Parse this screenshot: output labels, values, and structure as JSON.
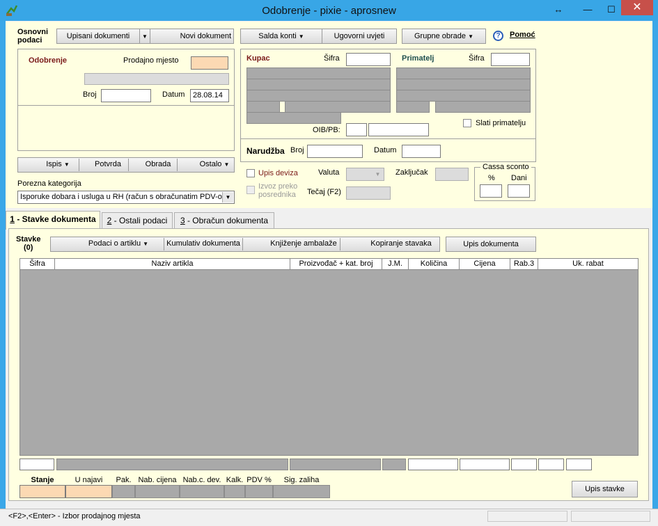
{
  "window": {
    "title": "Odobrenje - pixie - aprosnew",
    "resize_icon": "↔",
    "minimize_icon": "—",
    "maximize_icon": "☐",
    "close_icon": "✕"
  },
  "colors": {
    "title_bar": "#38a6e6",
    "panel_bg": "#ffffe1",
    "section_label": "#7a1a1a",
    "primatelj_label": "#1f4f4f",
    "readonly_gray": "#a9a9a9",
    "peach": "#fcd9b3"
  },
  "toolbar": {
    "section_label_line1": "Osnovni",
    "section_label_line2": "podaci",
    "upisani_dokumenti": "Upisani dokumenti",
    "novi_dokument": "Novi dokument",
    "salda_konti": "Salda konti",
    "ugovorni_uvjeti": "Ugovorni uvjeti",
    "grupne_obrade": "Grupne obrade",
    "help_icon": "?",
    "pomoc": "Pomoć"
  },
  "odobrenje": {
    "title": "Odobrenje",
    "prodajno_mjesto_label": "Prodajno mjesto",
    "prodajno_mjesto_value": "",
    "broj_label": "Broj",
    "broj_value": "",
    "datum_label": "Datum",
    "datum_value": "28.08.14"
  },
  "actions": {
    "ispis": "Ispis",
    "potvrda": "Potvrda",
    "obrada": "Obrada",
    "ostalo": "Ostalo"
  },
  "porezna": {
    "label": "Porezna kategorija",
    "selected": "Isporuke dobara i usluga u RH (račun s obračunatim PDV-om)"
  },
  "kupac": {
    "title": "Kupac",
    "sifra_label": "Šifra",
    "oib_label": "OIB/PB:"
  },
  "primatelj": {
    "title": "Primatelj",
    "sifra_label": "Šifra",
    "slati_label": "Slati primatelju"
  },
  "narudzba": {
    "title": "Narudžba",
    "broj_label": "Broj",
    "datum_label": "Datum"
  },
  "deviza": {
    "upis_deviza": "Upis deviza",
    "izvoz_line1": "Izvoz preko",
    "izvoz_line2": "posrednika",
    "valuta_label": "Valuta",
    "tecaj_label": "Tečaj (F2)",
    "zakljucak_label": "Zaključak"
  },
  "cassa": {
    "title": "Cassa sconto",
    "percent_label": "%",
    "dani_label": "Dani"
  },
  "tabs": [
    {
      "num": "1",
      "label": " - Stavke dokumenta"
    },
    {
      "num": "2",
      "label": " - Ostali podaci"
    },
    {
      "num": "3",
      "label": " - Obračun dokumenta"
    }
  ],
  "stavke": {
    "label_line1": "Stavke",
    "label_line2": "(0)",
    "podaci_o_artiklu": "Podaci o artiklu",
    "kumulativ": "Kumulativ dokumenta",
    "knjizenje": "Knjiženje ambalaže",
    "kopiranje": "Kopiranje stavaka",
    "upis_dokumenta": "Upis dokumenta"
  },
  "grid_columns": [
    "Šifra",
    "Naziv artikla",
    "Proizvođač + kat. broj",
    "J.M.",
    "Količina",
    "Cijena",
    "Rab.3",
    "Uk. rabat"
  ],
  "summary_columns": [
    "Stanje",
    "U najavi",
    "Pak.",
    "Nab. cijena",
    "Nab.c. dev.",
    "Kalk.",
    "PDV %",
    "Sig. zaliha"
  ],
  "upis_stavke": "Upis stavke",
  "status": {
    "hint": "<F2>,<Enter> - Izbor prodajnog mjesta"
  }
}
